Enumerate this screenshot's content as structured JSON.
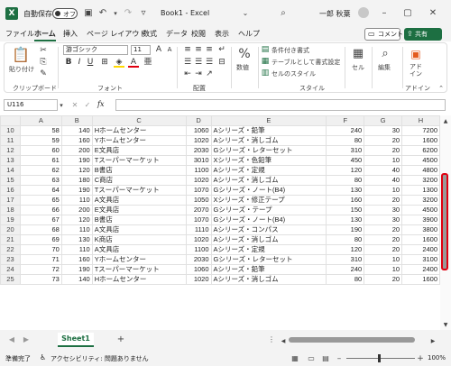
{
  "titlebar": {
    "autosave_label": "自動保存",
    "autosave_state": "オフ",
    "doc_title": "Book1 - Excel",
    "user_name": "一郎 秋葉"
  },
  "tabs": [
    "ファイル",
    "ホーム",
    "挿入",
    "ページ レイアウト",
    "数式",
    "データ",
    "校閲",
    "表示",
    "ヘルプ"
  ],
  "active_tab": "ホーム",
  "comment_label": "コメント",
  "share_label": "共有",
  "ribbon": {
    "paste_label": "貼り付け",
    "clipboard_group": "クリップボード",
    "font_name": "游ゴシック",
    "font_size": "11",
    "font_group": "フォント",
    "align_group": "配置",
    "number_label": "数値",
    "cond_format": "条件付き書式",
    "table_format": "テーブルとして書式設定",
    "cell_style": "セルのスタイル",
    "style_group": "スタイル",
    "cell_label": "セル",
    "edit_label": "編集",
    "addin_label": "アド イン",
    "addin_group": "アドイン"
  },
  "namebox": "U116",
  "fx_label": "fx",
  "columns": [
    "A",
    "B",
    "C",
    "D",
    "E",
    "F",
    "G",
    "H"
  ],
  "rows": [
    {
      "n": "10",
      "a": "58",
      "b": "140",
      "c": "Hホームセンター",
      "d": "1060",
      "e": "Aシリーズ・鉛筆",
      "f": "240",
      "g": "30",
      "h": "7200"
    },
    {
      "n": "11",
      "a": "59",
      "b": "160",
      "c": "Yホームセンター",
      "d": "1020",
      "e": "Aシリーズ・消しゴム",
      "f": "80",
      "g": "20",
      "h": "1600"
    },
    {
      "n": "12",
      "a": "60",
      "b": "200",
      "c": "E文具店",
      "d": "2030",
      "e": "Gシリーズ・レターセット",
      "f": "310",
      "g": "20",
      "h": "6200"
    },
    {
      "n": "13",
      "a": "61",
      "b": "190",
      "c": "Tスーパーマーケット",
      "d": "3010",
      "e": "Xシリーズ・色鉛筆",
      "f": "450",
      "g": "10",
      "h": "4500"
    },
    {
      "n": "14",
      "a": "62",
      "b": "120",
      "c": "B書店",
      "d": "1100",
      "e": "Aシリーズ・定規",
      "f": "120",
      "g": "40",
      "h": "4800"
    },
    {
      "n": "15",
      "a": "63",
      "b": "180",
      "c": "C商店",
      "d": "1020",
      "e": "Aシリーズ・消しゴム",
      "f": "80",
      "g": "40",
      "h": "3200"
    },
    {
      "n": "16",
      "a": "64",
      "b": "190",
      "c": "Tスーパーマーケット",
      "d": "1070",
      "e": "Gシリーズ・ノート(B4)",
      "f": "130",
      "g": "10",
      "h": "1300"
    },
    {
      "n": "17",
      "a": "65",
      "b": "110",
      "c": "A文具店",
      "d": "1050",
      "e": "Xシリーズ・修正テープ",
      "f": "160",
      "g": "20",
      "h": "3200"
    },
    {
      "n": "18",
      "a": "66",
      "b": "200",
      "c": "E文具店",
      "d": "2070",
      "e": "Gシリーズ・テープ",
      "f": "150",
      "g": "30",
      "h": "4500"
    },
    {
      "n": "19",
      "a": "67",
      "b": "120",
      "c": "B書店",
      "d": "1070",
      "e": "Gシリーズ・ノート(B4)",
      "f": "130",
      "g": "30",
      "h": "3900"
    },
    {
      "n": "20",
      "a": "68",
      "b": "110",
      "c": "A文具店",
      "d": "1110",
      "e": "Aシリーズ・コンパス",
      "f": "190",
      "g": "20",
      "h": "3800"
    },
    {
      "n": "21",
      "a": "69",
      "b": "130",
      "c": "K商店",
      "d": "1020",
      "e": "Aシリーズ・消しゴム",
      "f": "80",
      "g": "20",
      "h": "1600"
    },
    {
      "n": "22",
      "a": "70",
      "b": "110",
      "c": "A文具店",
      "d": "1100",
      "e": "Aシリーズ・定規",
      "f": "120",
      "g": "20",
      "h": "2400"
    },
    {
      "n": "23",
      "a": "71",
      "b": "160",
      "c": "Yホームセンター",
      "d": "2030",
      "e": "Gシリーズ・レターセット",
      "f": "310",
      "g": "10",
      "h": "3100"
    },
    {
      "n": "24",
      "a": "72",
      "b": "190",
      "c": "Tスーパーマーケット",
      "d": "1060",
      "e": "Aシリーズ・鉛筆",
      "f": "240",
      "g": "10",
      "h": "2400"
    },
    {
      "n": "25",
      "a": "73",
      "b": "140",
      "c": "Hホームセンター",
      "d": "1020",
      "e": "Aシリーズ・消しゴム",
      "f": "80",
      "g": "20",
      "h": "1600"
    }
  ],
  "sheet_name": "Sheet1",
  "status": {
    "ready": "準備完了",
    "accessibility": "アクセシビリティ: 問題ありません",
    "zoom": "100%"
  },
  "colors": {
    "excel_green": "#1d6f42",
    "highlight": "#e00010"
  }
}
